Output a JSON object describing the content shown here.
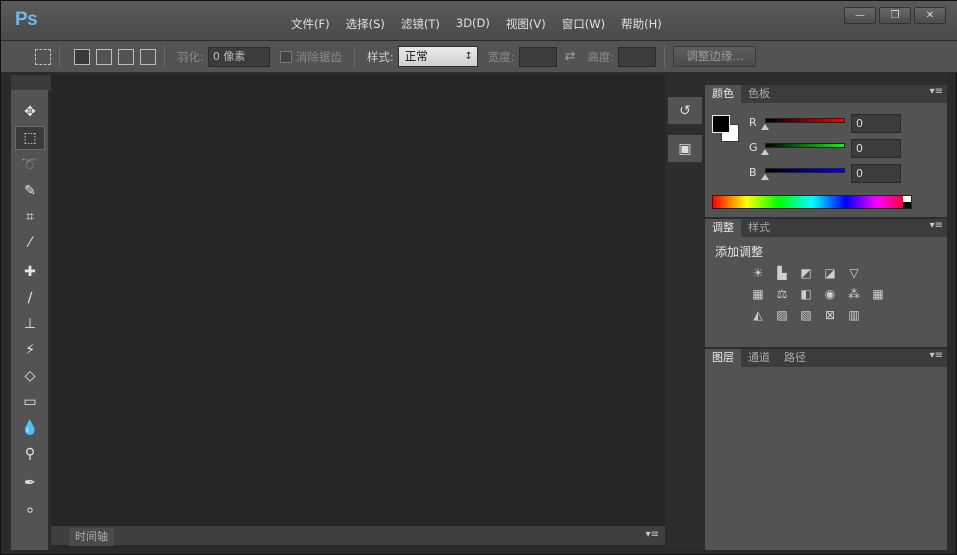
{
  "app": {
    "logo": "Ps"
  },
  "menu": [
    "文件(F)",
    "选择(S)",
    "滤镜(T)",
    "3D(D)",
    "视图(V)",
    "窗口(W)",
    "帮助(H)"
  ],
  "window_buttons": [
    "—",
    "❐",
    "✕"
  ],
  "options": {
    "feather_label": "羽化:",
    "feather_value": "0 像素",
    "antialias_label": "消除锯齿",
    "style_label": "样式:",
    "style_value": "正常",
    "width_label": "宽度:",
    "height_label": "高度:",
    "refine_edge": "调整边缘..."
  },
  "timeline": {
    "tab": "时间轴"
  },
  "color_panel": {
    "tabs": [
      "颜色",
      "色板"
    ],
    "channels": [
      {
        "label": "R",
        "value": "0",
        "gradient": "#ff0000"
      },
      {
        "label": "G",
        "value": "0",
        "gradient": "#00ff00"
      },
      {
        "label": "B",
        "value": "0",
        "gradient": "#0000ff"
      }
    ]
  },
  "adjust_panel": {
    "tabs": [
      "调整",
      "样式"
    ],
    "title": "添加调整"
  },
  "layers_panel": {
    "tabs": [
      "图层",
      "通道",
      "路径"
    ]
  }
}
